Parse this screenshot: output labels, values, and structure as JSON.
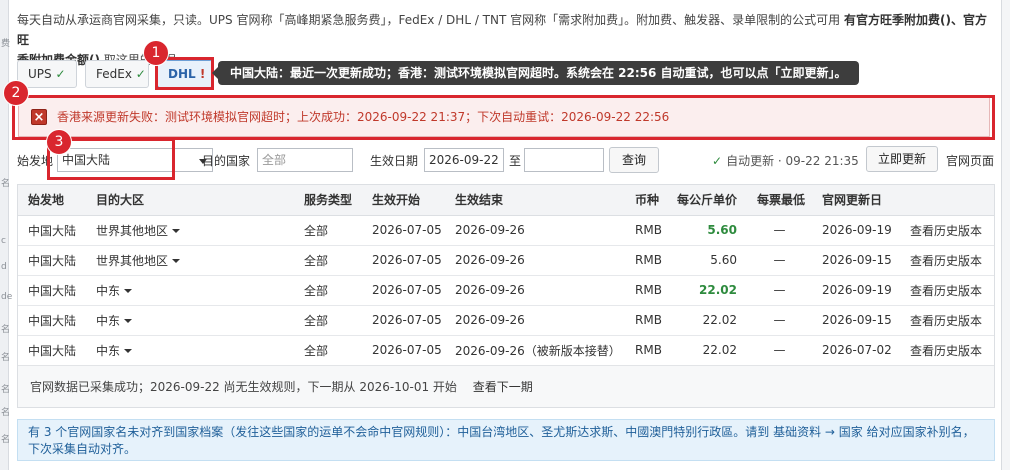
{
  "intro": {
    "line1_a": "每天自动从承运商官网采集，只读。UPS 官网称「高峰期紧急服务费」，FedEx / DHL / TNT 官网称「需求附加费」。附加费、触发器、录单限制的公式可用",
    "line1_b": "有官方旺季附加费()、官方旺",
    "line2_b": "季附加费金额()",
    "line2_c": "取这里的数据。"
  },
  "chips": [
    {
      "label": "UPS",
      "mark": "✓"
    },
    {
      "label": "FedEx",
      "mark": "✓"
    },
    {
      "label": "DHL",
      "mark": "!"
    }
  ],
  "tooltip": "中国大陆：最近一次更新成功；香港：测试环境模拟官网超时。系统会在 22:56 自动重试，也可以点「立即更新」。",
  "callouts": [
    "1",
    "2",
    "3"
  ],
  "alert": {
    "icon": "close-square-icon",
    "text": "香港来源更新失败：测试环境模拟官网超时；上次成功：2026-09-22 21:37；下次自动重试：2026-09-22 22:56"
  },
  "filters": {
    "origin_label": "始发地",
    "origin_value": "中国大陆",
    "dest_label": "目的国家",
    "dest_placeholder": "全部",
    "date_label": "生效日期",
    "date_value": "2026-09-22",
    "to_label": "至",
    "to_value": "",
    "query_label": "查询",
    "auto_status": "自动更新 · 09-22 21:35",
    "update_label": "立即更新",
    "site_label": "官网页面"
  },
  "table": {
    "headers": [
      "始发地",
      "目的大区",
      "服务类型",
      "生效开始",
      "生效结束",
      "币种",
      "每公斤单价",
      "每票最低",
      "官网更新日",
      ""
    ],
    "rows": [
      {
        "origin": "中国大陆",
        "region": "世界其他地区",
        "service": "全部",
        "start": "2026-07-05",
        "end": "2026-09-26",
        "currency": "RMB",
        "price": "5.60",
        "min": "—",
        "updated": "2026-09-19",
        "action": "查看历史版本",
        "highlight": true
      },
      {
        "origin": "中国大陆",
        "region": "世界其他地区",
        "service": "全部",
        "start": "2026-07-05",
        "end": "2026-09-26",
        "currency": "RMB",
        "price": "5.60",
        "min": "—",
        "updated": "2026-09-15",
        "action": "查看历史版本",
        "highlight": false
      },
      {
        "origin": "中国大陆",
        "region": "中东",
        "service": "全部",
        "start": "2026-07-05",
        "end": "2026-09-26",
        "currency": "RMB",
        "price": "22.02",
        "min": "—",
        "updated": "2026-09-19",
        "action": "查看历史版本",
        "highlight": true
      },
      {
        "origin": "中国大陆",
        "region": "中东",
        "service": "全部",
        "start": "2026-07-05",
        "end": "2026-09-26",
        "currency": "RMB",
        "price": "22.02",
        "min": "—",
        "updated": "2026-09-15",
        "action": "查看历史版本",
        "highlight": false
      },
      {
        "origin": "中国大陆",
        "region": "中东",
        "service": "全部",
        "start": "2026-07-05",
        "end": "2026-09-26（被新版本接替）",
        "currency": "RMB",
        "price": "22.02",
        "min": "—",
        "updated": "2026-07-02",
        "action": "查看历史版本",
        "highlight": false
      }
    ],
    "footer_text": "官网数据已采集成功；2026-09-22 尚无生效规则，下一期从 2026-10-01 开始",
    "footer_link": "查看下一期"
  },
  "info": "有 3 个官网国家名未对齐到国家档案（发往这些国家的运单不会命中官网规则）：中国台湾地区、圣尤斯达求斯、中國澳門特别行政區。请到 基础资料 → 国家 给对应国家补别名，下次采集自动对齐。",
  "colors": {
    "accent_red": "#d9262e",
    "ok_green": "#2e8b3e",
    "info_blue": "#1f5f99"
  }
}
